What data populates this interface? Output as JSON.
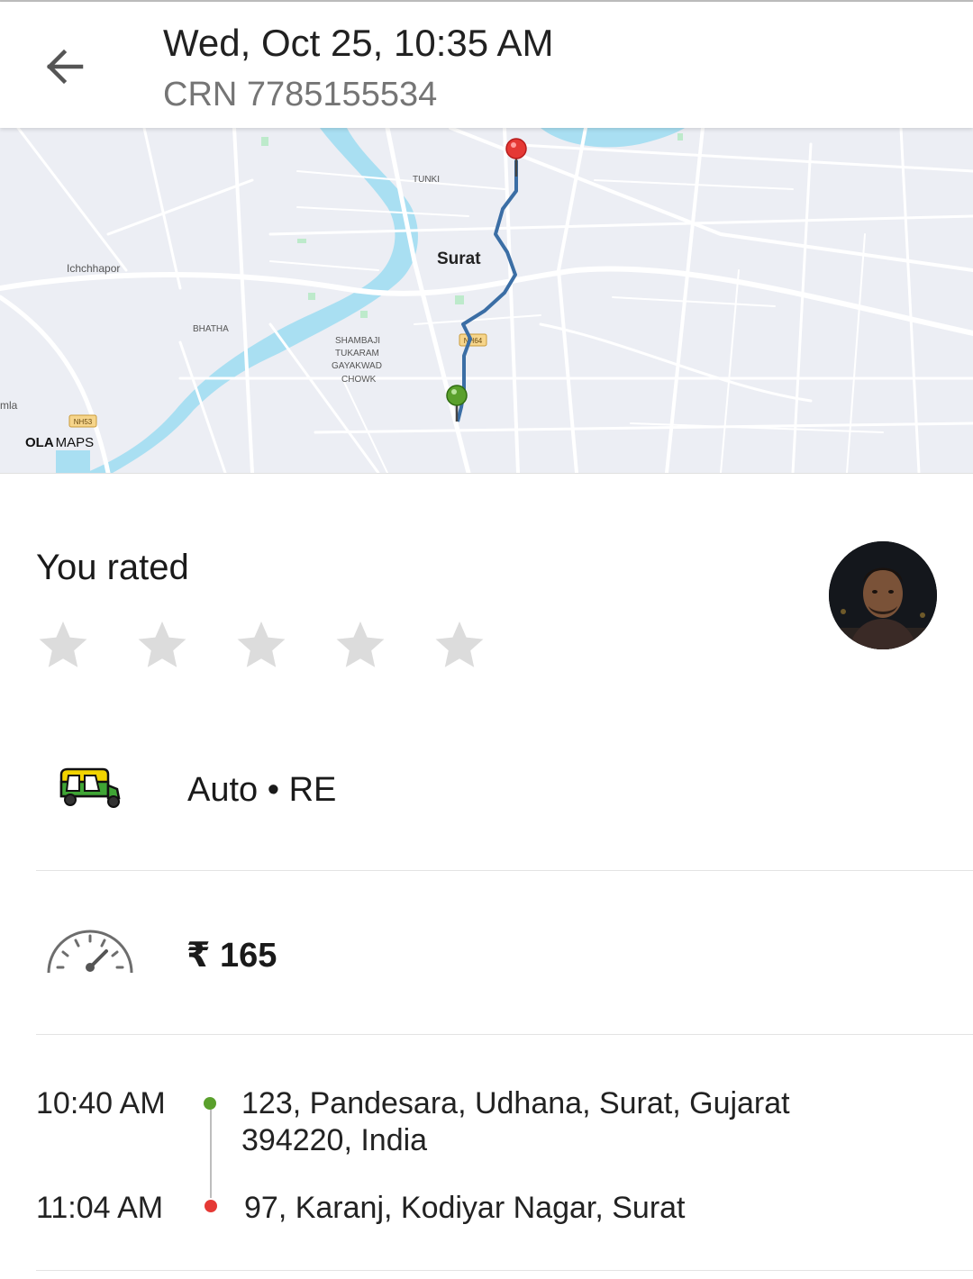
{
  "header": {
    "title": "Wed, Oct 25, 10:35 AM",
    "crn": "CRN 7785155534",
    "back_icon": "arrow-left-icon"
  },
  "map": {
    "city_label": "Surat",
    "labels": {
      "tunki": "TUNKI",
      "ichchhapor": "Ichchhapor",
      "bhatha": "BHATHA",
      "chowk_1": "SHAMBAJI",
      "chowk_2": "TUKARAM",
      "chowk_3": "GAYAKWAD",
      "chowk_4": "CHOWK",
      "edge": "mla",
      "nh53": "NH53",
      "nh64": "NH64"
    },
    "brand_bold": "OLA",
    "brand_light": "MAPS",
    "colors": {
      "route": "#3b6ea5",
      "water": "#a9dff2",
      "pickup_pin": "#5aa02c",
      "drop_pin": "#e53935"
    }
  },
  "rating": {
    "label": "You rated",
    "stars_total": 5,
    "stars_filled": 0,
    "star_icon": "star-icon"
  },
  "vehicle": {
    "icon": "auto-rickshaw-icon",
    "label": "Auto • RE"
  },
  "fare": {
    "icon": "speedometer-icon",
    "label": "₹ 165"
  },
  "trip": {
    "pickup": {
      "time": "10:40 AM",
      "address_line1": "123, Pandesara, Udhana, Surat, Gujarat",
      "address_line2": "394220, India",
      "color": "#5aa02c"
    },
    "drop": {
      "time": "11:04 AM",
      "address": "97, Karanj, Kodiyar Nagar, Surat",
      "color": "#e53935"
    }
  }
}
